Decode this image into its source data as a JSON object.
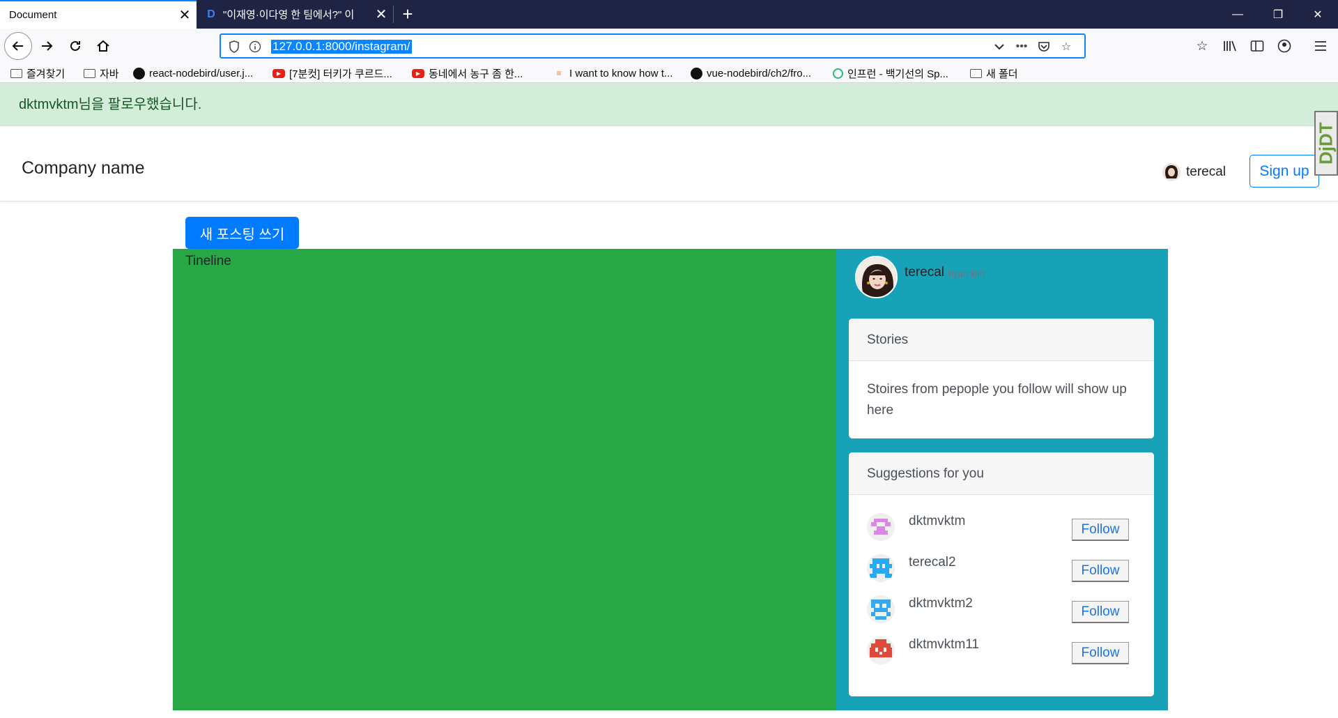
{
  "browser": {
    "tabs": [
      {
        "title": "Document",
        "active": true
      },
      {
        "title": "\"이재영·이다영 한 팀에서?\" 이",
        "active": false,
        "favicon": "D"
      }
    ],
    "new_tab_icon": "+",
    "window_controls": {
      "minimize": "—",
      "restore": "❐",
      "close": "✕"
    },
    "url": "127.0.0.1:8000/instagram/",
    "bookmarks": [
      {
        "label": "즐겨찾기",
        "icon": "folder-icon"
      },
      {
        "label": "자바",
        "icon": "folder-icon"
      },
      {
        "label": "react-nodebird/user.j...",
        "icon": "github-icon"
      },
      {
        "label": "[7분컷] 터키가 쿠르드...",
        "icon": "youtube-icon"
      },
      {
        "label": "동네에서 농구 좀 한...",
        "icon": "youtube-icon"
      },
      {
        "label": "I want to know how t...",
        "icon": "stackoverflow-icon"
      },
      {
        "label": "vue-nodebird/ch2/fro...",
        "icon": "github-icon"
      },
      {
        "label": "인프런 - 백기선의 Sp...",
        "icon": "inflearn-icon"
      },
      {
        "label": "새 폴더",
        "icon": "folder-icon"
      }
    ]
  },
  "alert": {
    "message": "dktmvktm님을 팔로우했습니다."
  },
  "extension_badge": "DjDT",
  "header": {
    "brand": "Company name",
    "username": "terecal",
    "signup_label": "Sign up"
  },
  "main": {
    "new_post_label": "새 포스팅 쓰기",
    "timeline_label": "Tineline"
  },
  "sidebar": {
    "profile": {
      "username": "terecal",
      "full_name": "hyun kim"
    },
    "stories": {
      "header": "Stories",
      "body": "Stoires from pepople you follow will show up here"
    },
    "suggestions": {
      "header": "Suggestions for you",
      "follow_label": "Follow",
      "users": [
        {
          "username": "dktmvktm",
          "avatar_color": "#d98ae0"
        },
        {
          "username": "terecal2",
          "avatar_color": "#2aa9f0"
        },
        {
          "username": "dktmvktm2",
          "avatar_color": "#35a9ef"
        },
        {
          "username": "dktmvktm11",
          "avatar_color": "#e04a3c"
        }
      ]
    }
  },
  "colors": {
    "primary": "#007bff",
    "timeline_bg": "#28a745",
    "sidebar_bg": "#17a2b8",
    "alert_bg": "#d4edda"
  }
}
